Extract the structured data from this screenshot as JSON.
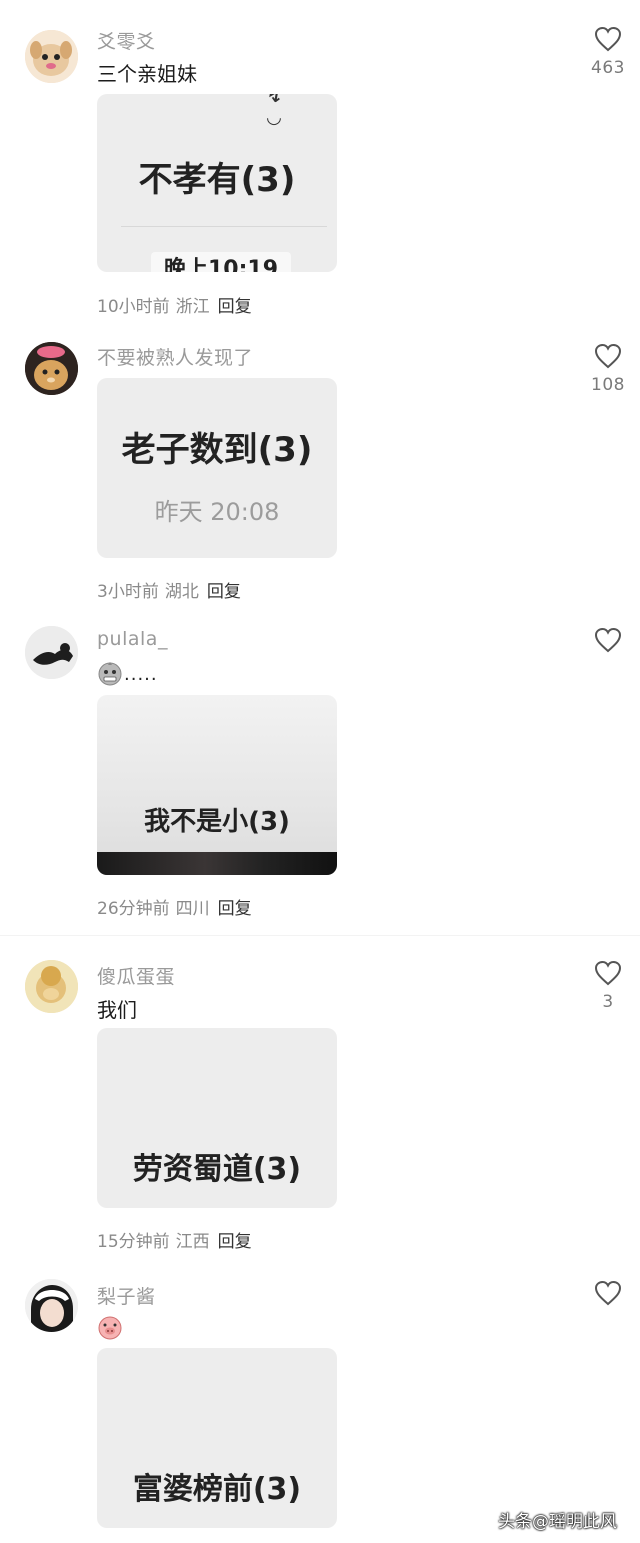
{
  "comments": [
    {
      "username": "爻零爻",
      "text": "三个亲姐妹",
      "card_title": "不孝有(3)",
      "card_chip": "晚上10:19",
      "time": "10小时前",
      "location": "浙江",
      "reply": "回复",
      "likes": "463"
    },
    {
      "username": "不要被熟人发现了",
      "card_title": "老子数到(3)",
      "card_sub": "昨天 20:08",
      "time": "3小时前",
      "location": "湖北",
      "reply": "回复",
      "likes": "108"
    },
    {
      "username": "pulala_",
      "text": ".....",
      "card_title": "我不是小(3)",
      "time": "26分钟前",
      "location": "四川",
      "reply": "回复",
      "likes": ""
    },
    {
      "username": "傻瓜蛋蛋",
      "text": "我们",
      "card_title": "劳资蜀道(3)",
      "time": "15分钟前",
      "location": "江西",
      "reply": "回复",
      "likes": "3"
    },
    {
      "username": "梨子酱",
      "card_title": "富婆榜前(3)",
      "likes": ""
    }
  ],
  "watermark": "头条@瑶明此风",
  "icons": {
    "like": "heart-outline-icon",
    "emoji_3": "grimace-emoji-icon",
    "emoji_5": "pig-face-emoji-icon"
  },
  "colors": {
    "card_bg": "#ededed",
    "meta_text": "#8a8a8a",
    "username": "#9a9a9a"
  }
}
